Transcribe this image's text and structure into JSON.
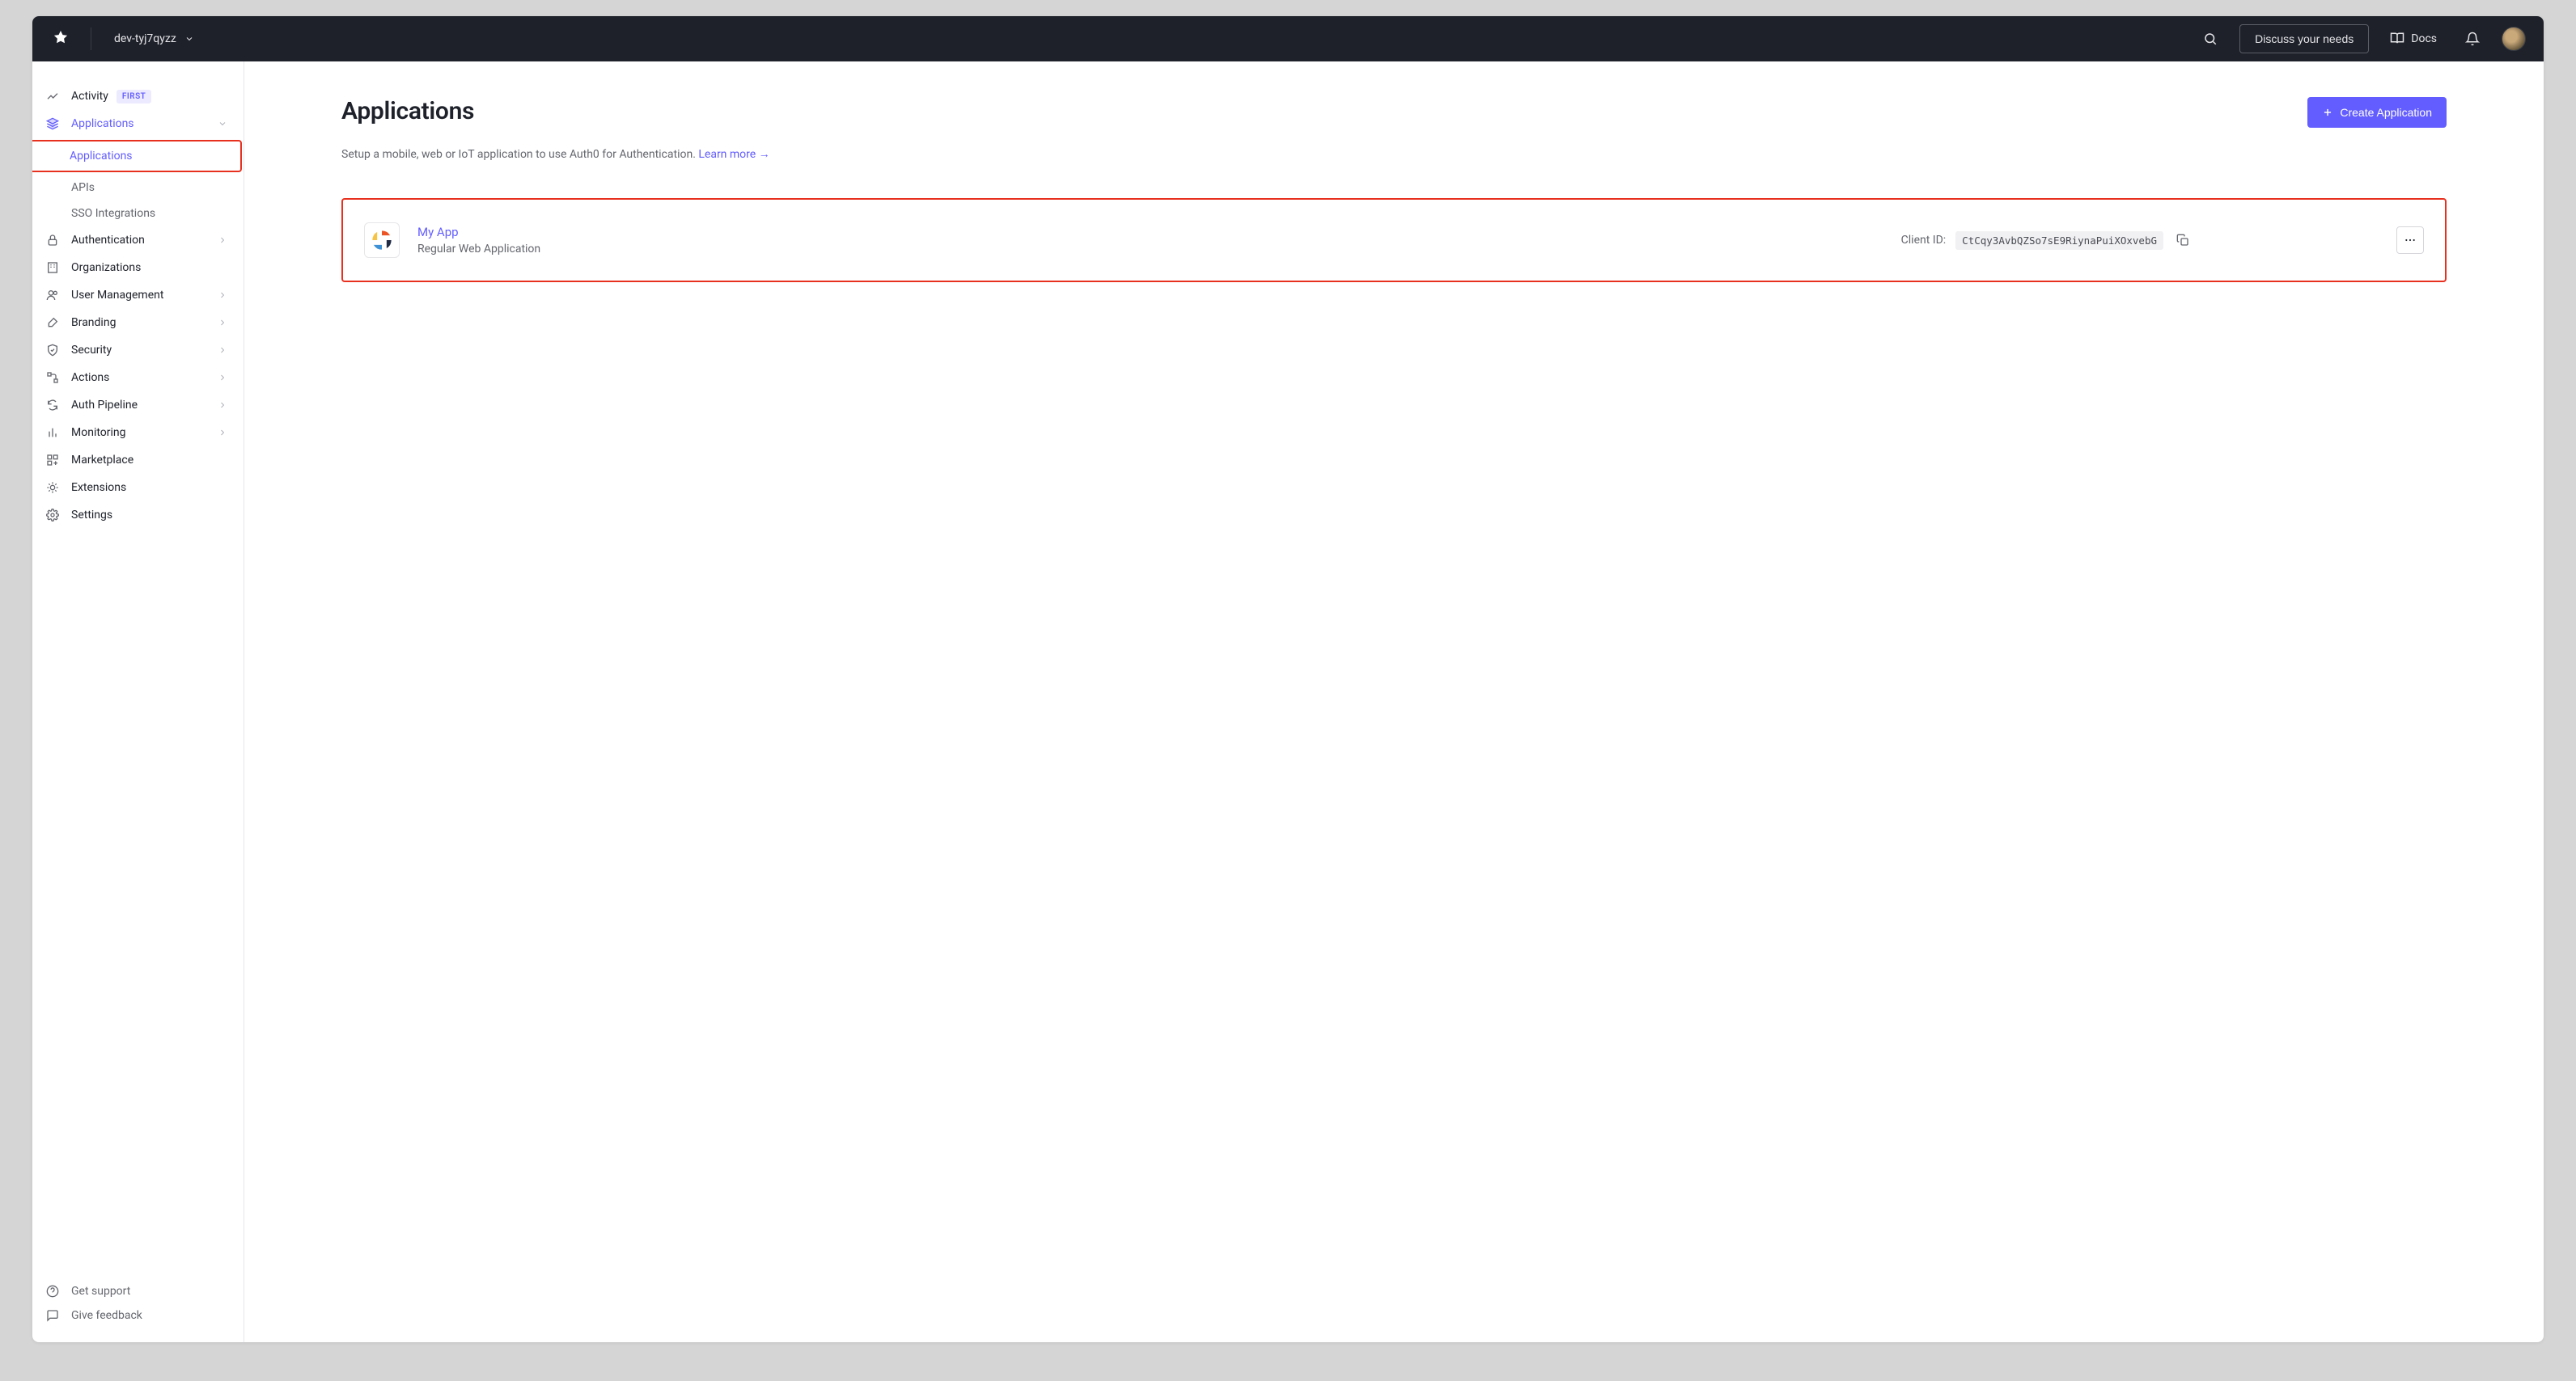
{
  "header": {
    "tenant_name": "dev-tyj7qyzz",
    "discuss_label": "Discuss your needs",
    "docs_label": "Docs"
  },
  "sidebar": {
    "items": [
      {
        "label": "Activity",
        "badge": "FIRST"
      },
      {
        "label": "Applications"
      },
      {
        "label": "Authentication"
      },
      {
        "label": "Organizations"
      },
      {
        "label": "User Management"
      },
      {
        "label": "Branding"
      },
      {
        "label": "Security"
      },
      {
        "label": "Actions"
      },
      {
        "label": "Auth Pipeline"
      },
      {
        "label": "Monitoring"
      },
      {
        "label": "Marketplace"
      },
      {
        "label": "Extensions"
      },
      {
        "label": "Settings"
      }
    ],
    "applications_sub": [
      {
        "label": "Applications"
      },
      {
        "label": "APIs"
      },
      {
        "label": "SSO Integrations"
      }
    ],
    "footer": [
      {
        "label": "Get support"
      },
      {
        "label": "Give feedback"
      }
    ]
  },
  "page": {
    "title": "Applications",
    "create_label": "Create Application",
    "description": "Setup a mobile, web or IoT application to use Auth0 for Authentication. ",
    "learn_more": "Learn more"
  },
  "apps": [
    {
      "name": "My App",
      "type": "Regular Web Application",
      "client_id_label": "Client ID:",
      "client_id": "CtCqy3AvbQZSo7sE9RiynaPuiXOxvebG"
    }
  ],
  "colors": {
    "accent": "#635dff",
    "highlight": "#e8301f",
    "topbar": "#1e212a"
  }
}
